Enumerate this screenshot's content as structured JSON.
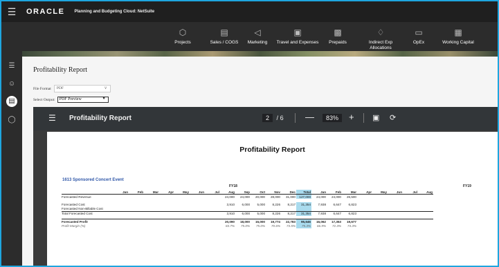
{
  "topbar": {
    "logo": "ORACLE",
    "app_name": "Planning and Budgeting Cloud: NetSuite"
  },
  "nav": [
    {
      "label": "Projects",
      "icon": "cube-icon"
    },
    {
      "label": "Sales / COGS",
      "icon": "bar-chart-icon"
    },
    {
      "label": "Marketing",
      "icon": "megaphone-icon"
    },
    {
      "label": "Travel and Expenses",
      "icon": "person-icon"
    },
    {
      "label": "Prepaids",
      "icon": "box-icon"
    },
    {
      "label": "Indirect Exp Allocations",
      "icon": "hierarchy-icon"
    },
    {
      "label": "OpEx",
      "icon": "monitor-icon"
    },
    {
      "label": "Working Capital",
      "icon": "calculator-icon"
    }
  ],
  "page": {
    "title": "Profitability Report",
    "file_format_label": "File Format",
    "file_format_value": "PDF",
    "select_output_label": "Select Output:",
    "select_output_value": "PDF Preview"
  },
  "viewer": {
    "title": "Profitability Report",
    "page_current": "2",
    "page_sep": "/",
    "page_total": "6",
    "zoom": "83%"
  },
  "report": {
    "title": "Profitability Report",
    "event": "1613 Sponsored Concert Event",
    "fy18": "FY18",
    "fy19": "FY19",
    "columns": [
      "Jan",
      "Feb",
      "Mar",
      "Apr",
      "May",
      "Jun",
      "Jul",
      "Aug",
      "Sep",
      "Oct",
      "Nov",
      "Dec",
      "Total",
      "Jan",
      "Feb",
      "Mar",
      "Apr",
      "May",
      "Jun",
      "Jul",
      "Aug"
    ],
    "rows": [
      {
        "label": "Forecasted Revenue",
        "values": [
          "",
          "",
          "",
          "",
          "",
          "",
          "",
          "24,000",
          "24,000",
          "20,000",
          "28,000",
          "31,000",
          "127,000",
          "24,000",
          "24,000",
          "26,500",
          "",
          "",
          "",
          "",
          ""
        ]
      },
      {
        "label": "Forecasted Cost",
        "values": [
          "",
          "",
          "",
          "",
          "",
          "",
          "",
          "3,910",
          "6,000",
          "5,000",
          "8,226",
          "8,217",
          "31,354",
          "7,938",
          "6,647",
          "6,823",
          "",
          "",
          "",
          "",
          ""
        ]
      },
      {
        "label": "Forecasted Non-Billable Cost",
        "values": [
          "",
          "",
          "",
          "",
          "",
          "",
          "",
          "",
          "",
          "",
          "",
          "",
          "",
          "",
          "",
          "",
          "",
          "",
          "",
          "",
          ""
        ]
      },
      {
        "label": "Total Forecasted Cost",
        "values": [
          "",
          "",
          "",
          "",
          "",
          "",
          "",
          "3,910",
          "6,000",
          "5,000",
          "8,226",
          "8,217",
          "31,354",
          "7,938",
          "6,647",
          "6,823",
          "",
          "",
          "",
          "",
          ""
        ]
      },
      {
        "label": "Forecasted Profit",
        "values": [
          "",
          "",
          "",
          "",
          "",
          "",
          "",
          "20,090",
          "18,000",
          "15,000",
          "19,774",
          "22,783",
          "95,646",
          "16,062",
          "17,353",
          "19,677",
          "",
          "",
          "",
          "",
          ""
        ]
      },
      {
        "label": "Profit Margin (%)",
        "values": [
          "",
          "",
          "",
          "",
          "",
          "",
          "",
          "83.7%",
          "75.0%",
          "75.0%",
          "70.6%",
          "73.5%",
          "75.3%",
          "66.9%",
          "72.3%",
          "74.3%",
          "",
          "",
          "",
          "",
          ""
        ]
      }
    ]
  },
  "colors": {
    "accent_blue": "#2e56a8",
    "total_highlight": "#a9dbee",
    "frame": "#1ea6df"
  }
}
